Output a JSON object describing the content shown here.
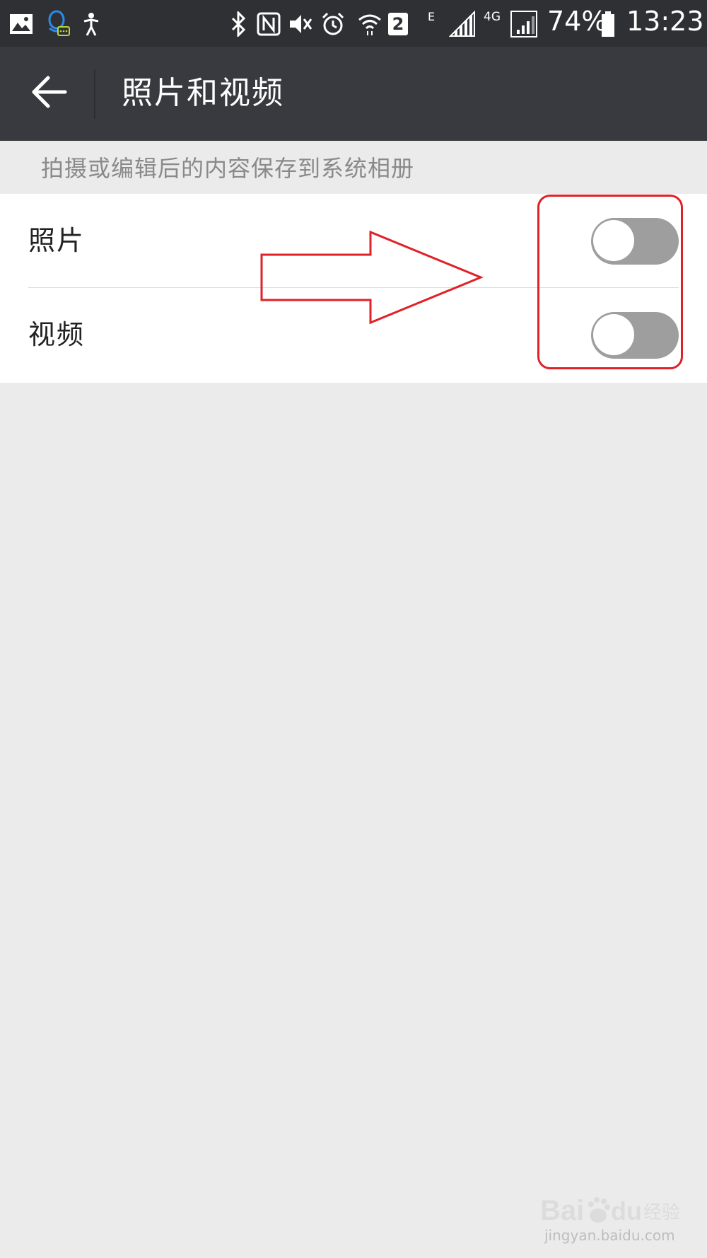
{
  "status_bar": {
    "battery_percent": "74%",
    "time": "13:23",
    "network_4g": "4G",
    "network_e": "E",
    "sim_slot": "2",
    "icons": [
      "gallery-icon",
      "qq-icon",
      "accessibility-icon",
      "bluetooth-icon",
      "nfc-icon",
      "vibrate-icon",
      "alarm-icon",
      "wifi-icon",
      "signal-icon",
      "battery-icon"
    ]
  },
  "toolbar": {
    "title": "照片和视频",
    "back_icon": "back-arrow-icon"
  },
  "section": {
    "hint": "拍摄或编辑后的内容保存到系统相册"
  },
  "settings": [
    {
      "label": "照片",
      "enabled": false
    },
    {
      "label": "视频",
      "enabled": false
    }
  ],
  "annotation": {
    "color": "#e02127"
  },
  "watermark": {
    "logo": "Bai du 经验",
    "url": "jingyan.baidu.com"
  }
}
